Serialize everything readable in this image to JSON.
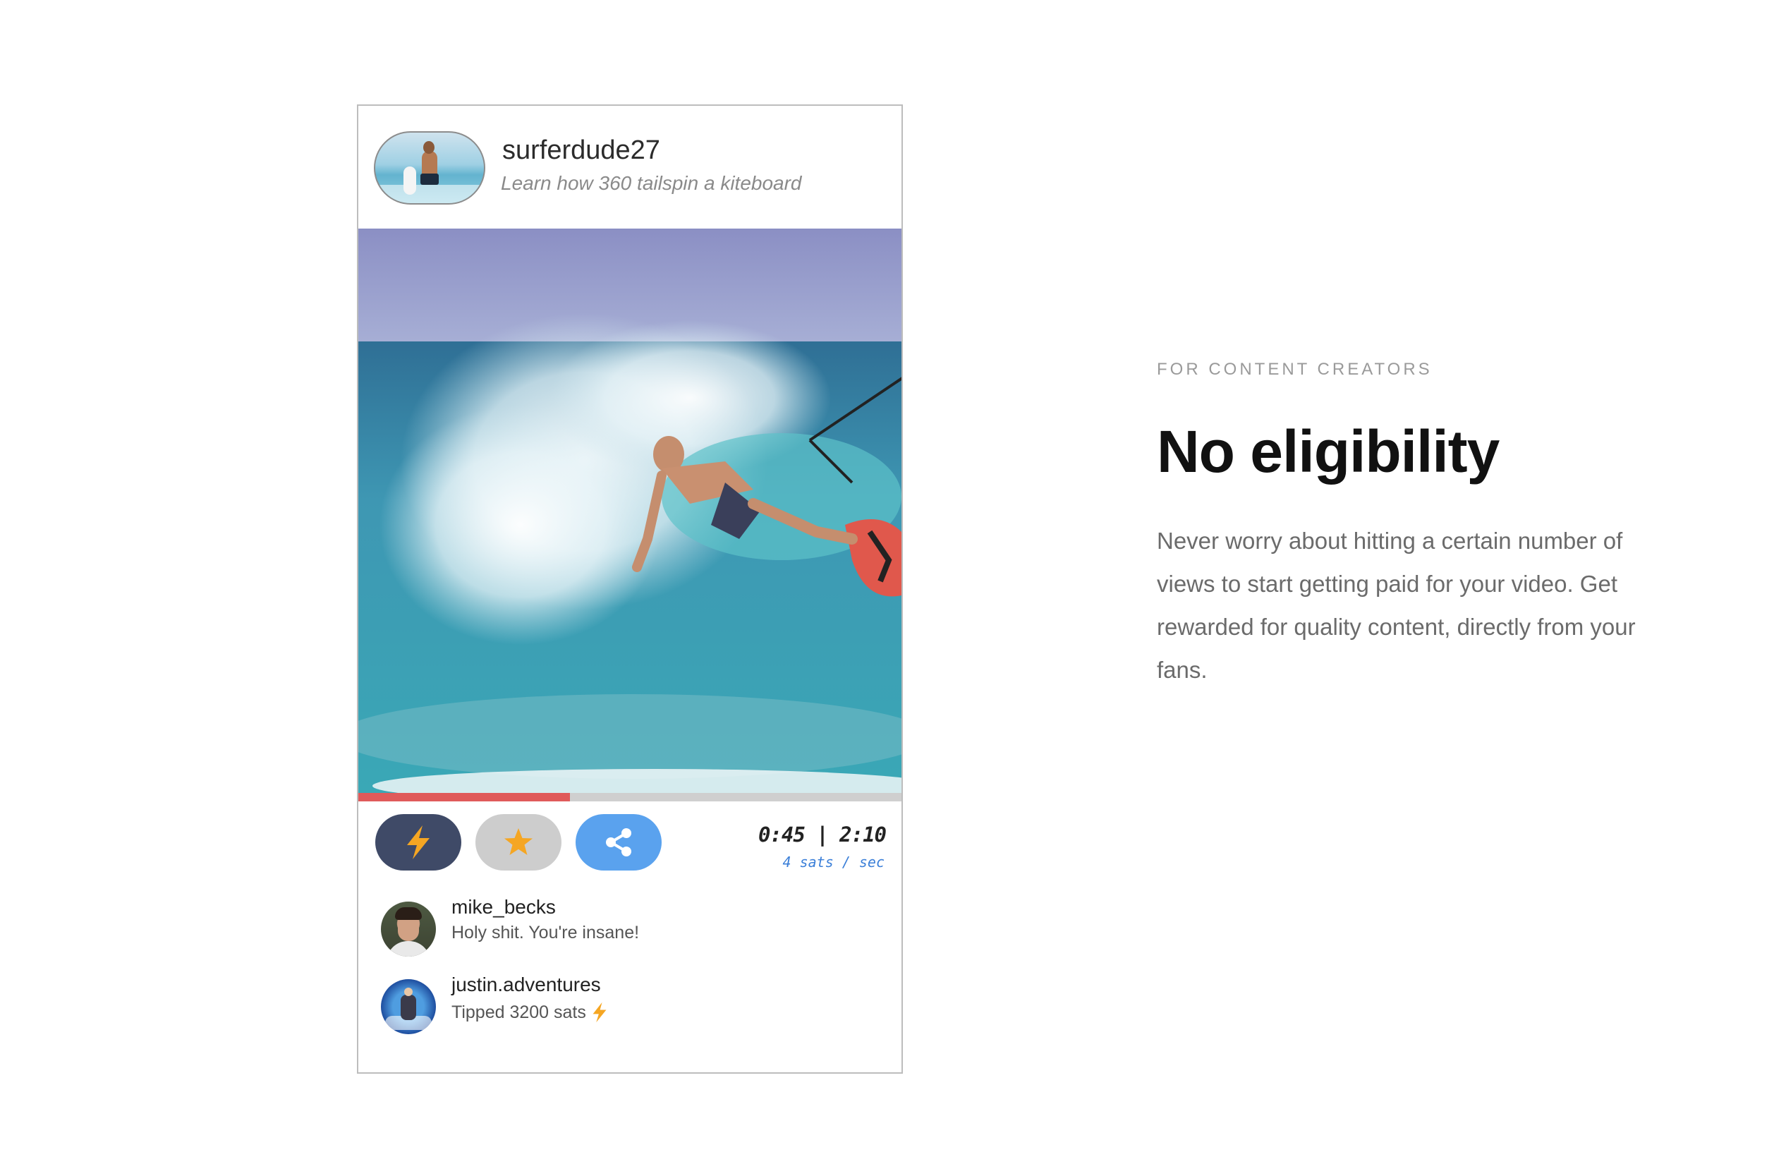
{
  "post": {
    "username": "surferdude27",
    "title": "Learn how 360 tailspin a kiteboard"
  },
  "player": {
    "progress": 0.39,
    "time": "0:45 | 2:10",
    "rate": "4 sats / sec",
    "colors": {
      "progress": "#e05a5a",
      "track": "#cfcfcf"
    }
  },
  "actions": [
    {
      "icon": "lightning-icon",
      "color": "#3f4a67"
    },
    {
      "icon": "star-icon",
      "color": "#cdcdcd"
    },
    {
      "icon": "share-icon",
      "color": "#5aa2ee"
    }
  ],
  "comments": [
    {
      "user": "mike_becks",
      "text": "Holy shit. You're insane!"
    },
    {
      "user": "justin.adventures",
      "text": "Tipped 3200 sats",
      "icon": "lightning-icon"
    }
  ],
  "promo": {
    "eyebrow": "FOR CONTENT CREATORS",
    "headline": "No eligibility",
    "body": "Never worry about hitting a certain number of views to start getting paid for your video. Get rewarded for quality content, directly from your fans."
  }
}
